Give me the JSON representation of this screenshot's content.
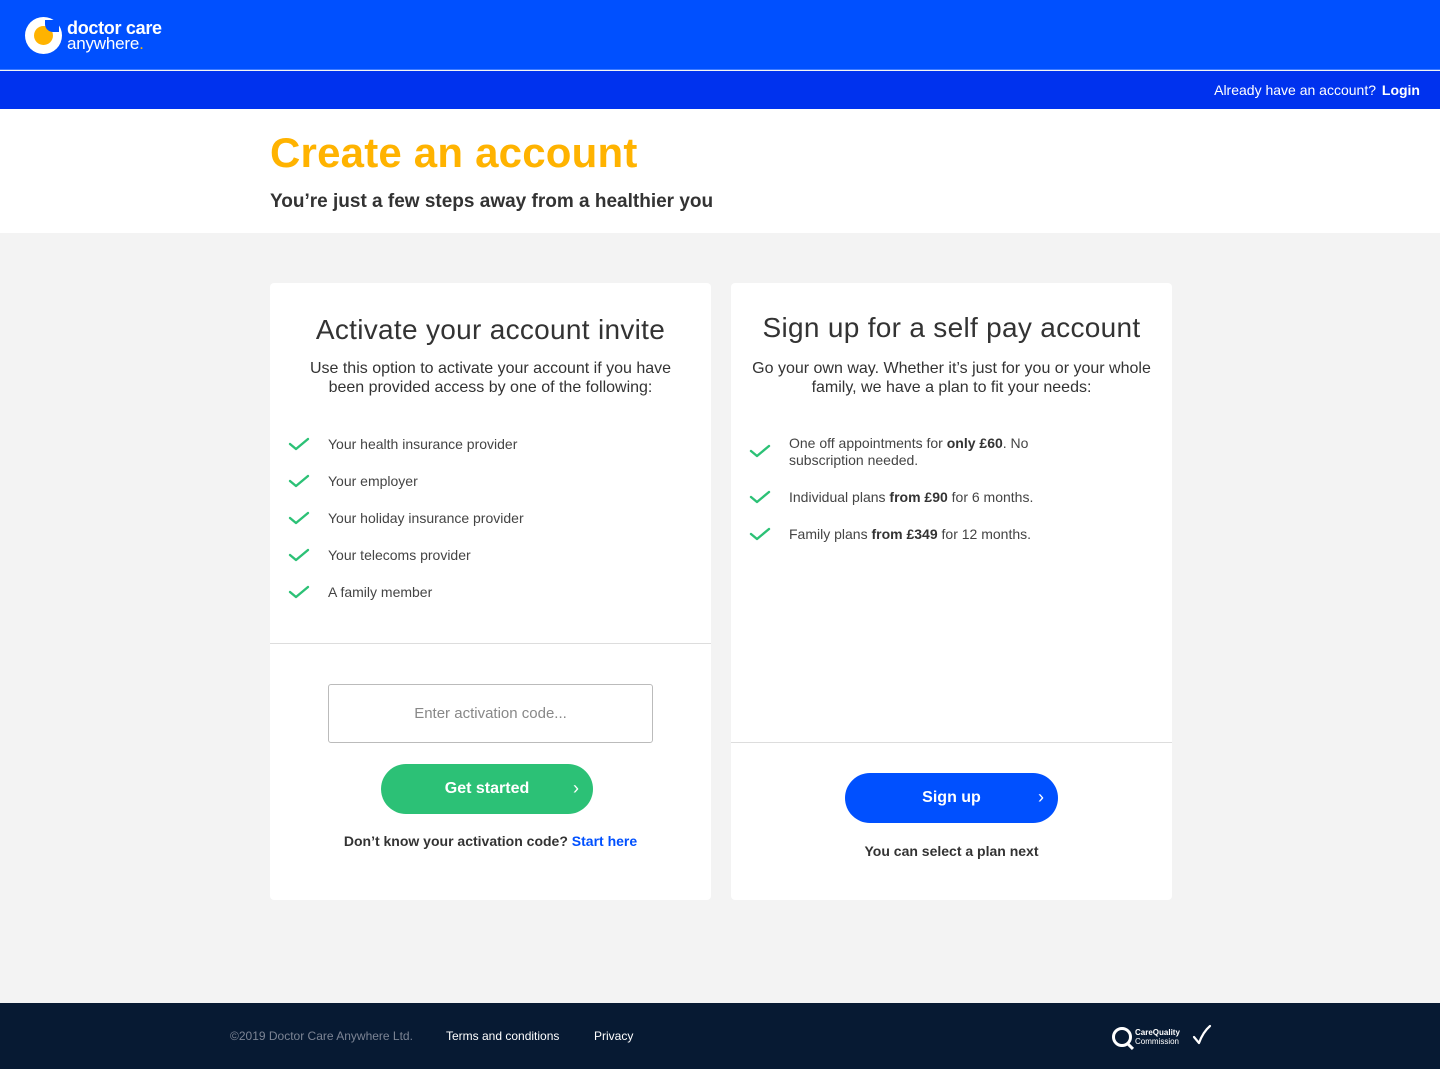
{
  "brand": {
    "line1": "doctor care",
    "line2": "anywhere",
    "line2_dot": ".",
    "colors": {
      "primary": "#0050ff",
      "accent": "#ffb300",
      "success": "#2cc176",
      "footer": "#071a33"
    }
  },
  "header": {
    "account_question": "Already have an account?",
    "login_label": "Login"
  },
  "hero": {
    "title": "Create an account",
    "subtitle": "You’re just a few steps away from a healthier you"
  },
  "activate": {
    "title": "Activate your account invite",
    "description": "Use this option to activate your account if you have been provided access by one of the following:",
    "items": [
      {
        "icon": "check-icon",
        "text": "Your health insurance provider"
      },
      {
        "icon": "check-icon",
        "text": "Your employer"
      },
      {
        "icon": "check-icon",
        "text": "Your holiday insurance provider"
      },
      {
        "icon": "check-icon",
        "text": "Your telecoms provider"
      },
      {
        "icon": "check-icon",
        "text": "A family member"
      }
    ],
    "input_placeholder": "Enter activation code...",
    "input_value": "",
    "button_label": "Get started",
    "button_icon": "chevron-right-icon",
    "hint_text": "Don’t know your activation code?",
    "hint_link": "Start here"
  },
  "selfpay": {
    "title": "Sign up for a self pay account",
    "description": "Go your own way. Whether it’s just for you or your whole family, we have a plan to fit your needs:",
    "items": [
      {
        "icon": "check-icon",
        "pre": "One off appointments for ",
        "bold": "only £60",
        "post": ". No subscription needed."
      },
      {
        "icon": "check-icon",
        "pre": "Individual plans ",
        "bold": "from £90",
        "post": " for 6 months."
      },
      {
        "icon": "check-icon",
        "pre": "Family plans ",
        "bold": "from £349",
        "post": " for 12 months."
      }
    ],
    "button_label": "Sign up",
    "button_icon": "chevron-right-icon",
    "hint_text": "You can select a plan next"
  },
  "footer": {
    "copyright": "©2019 Doctor Care Anywhere Ltd.",
    "terms_label": "Terms and conditions",
    "privacy_label": "Privacy",
    "cqc_line1": "CareQuality",
    "cqc_line2": "Commission"
  }
}
